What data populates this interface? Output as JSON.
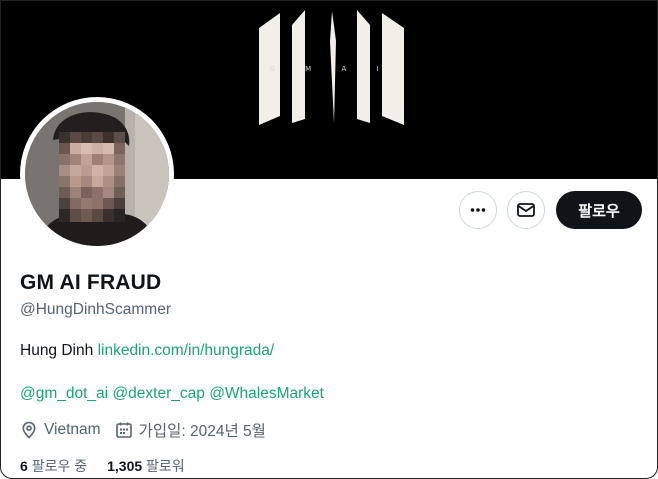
{
  "banner": {
    "logo_text": "G M A I"
  },
  "profile": {
    "display_name": "GM AI FRAUD",
    "handle": "@HungDinhScammer",
    "bio_name": "Hung Dinh",
    "bio_link": "linkedin.com/in/hungrada/",
    "mentions": [
      "@gm_dot_ai",
      "@dexter_cap",
      "@WhalesMarket"
    ],
    "location": "Vietnam",
    "joined": "가입일: 2024년 5월",
    "following_count": "6",
    "following_label": "팔로우 중",
    "followers_count": "1,305",
    "followers_label": "팔로워"
  },
  "actions": {
    "more_label": "•••",
    "follow_label": "팔로우"
  },
  "colors": {
    "link": "#1da37a",
    "banner": "#000000",
    "follow_button": "#0f1419",
    "secondary_text": "#536471"
  },
  "icons": [
    "more-icon",
    "mail-icon",
    "location-pin-icon",
    "calendar-icon"
  ]
}
